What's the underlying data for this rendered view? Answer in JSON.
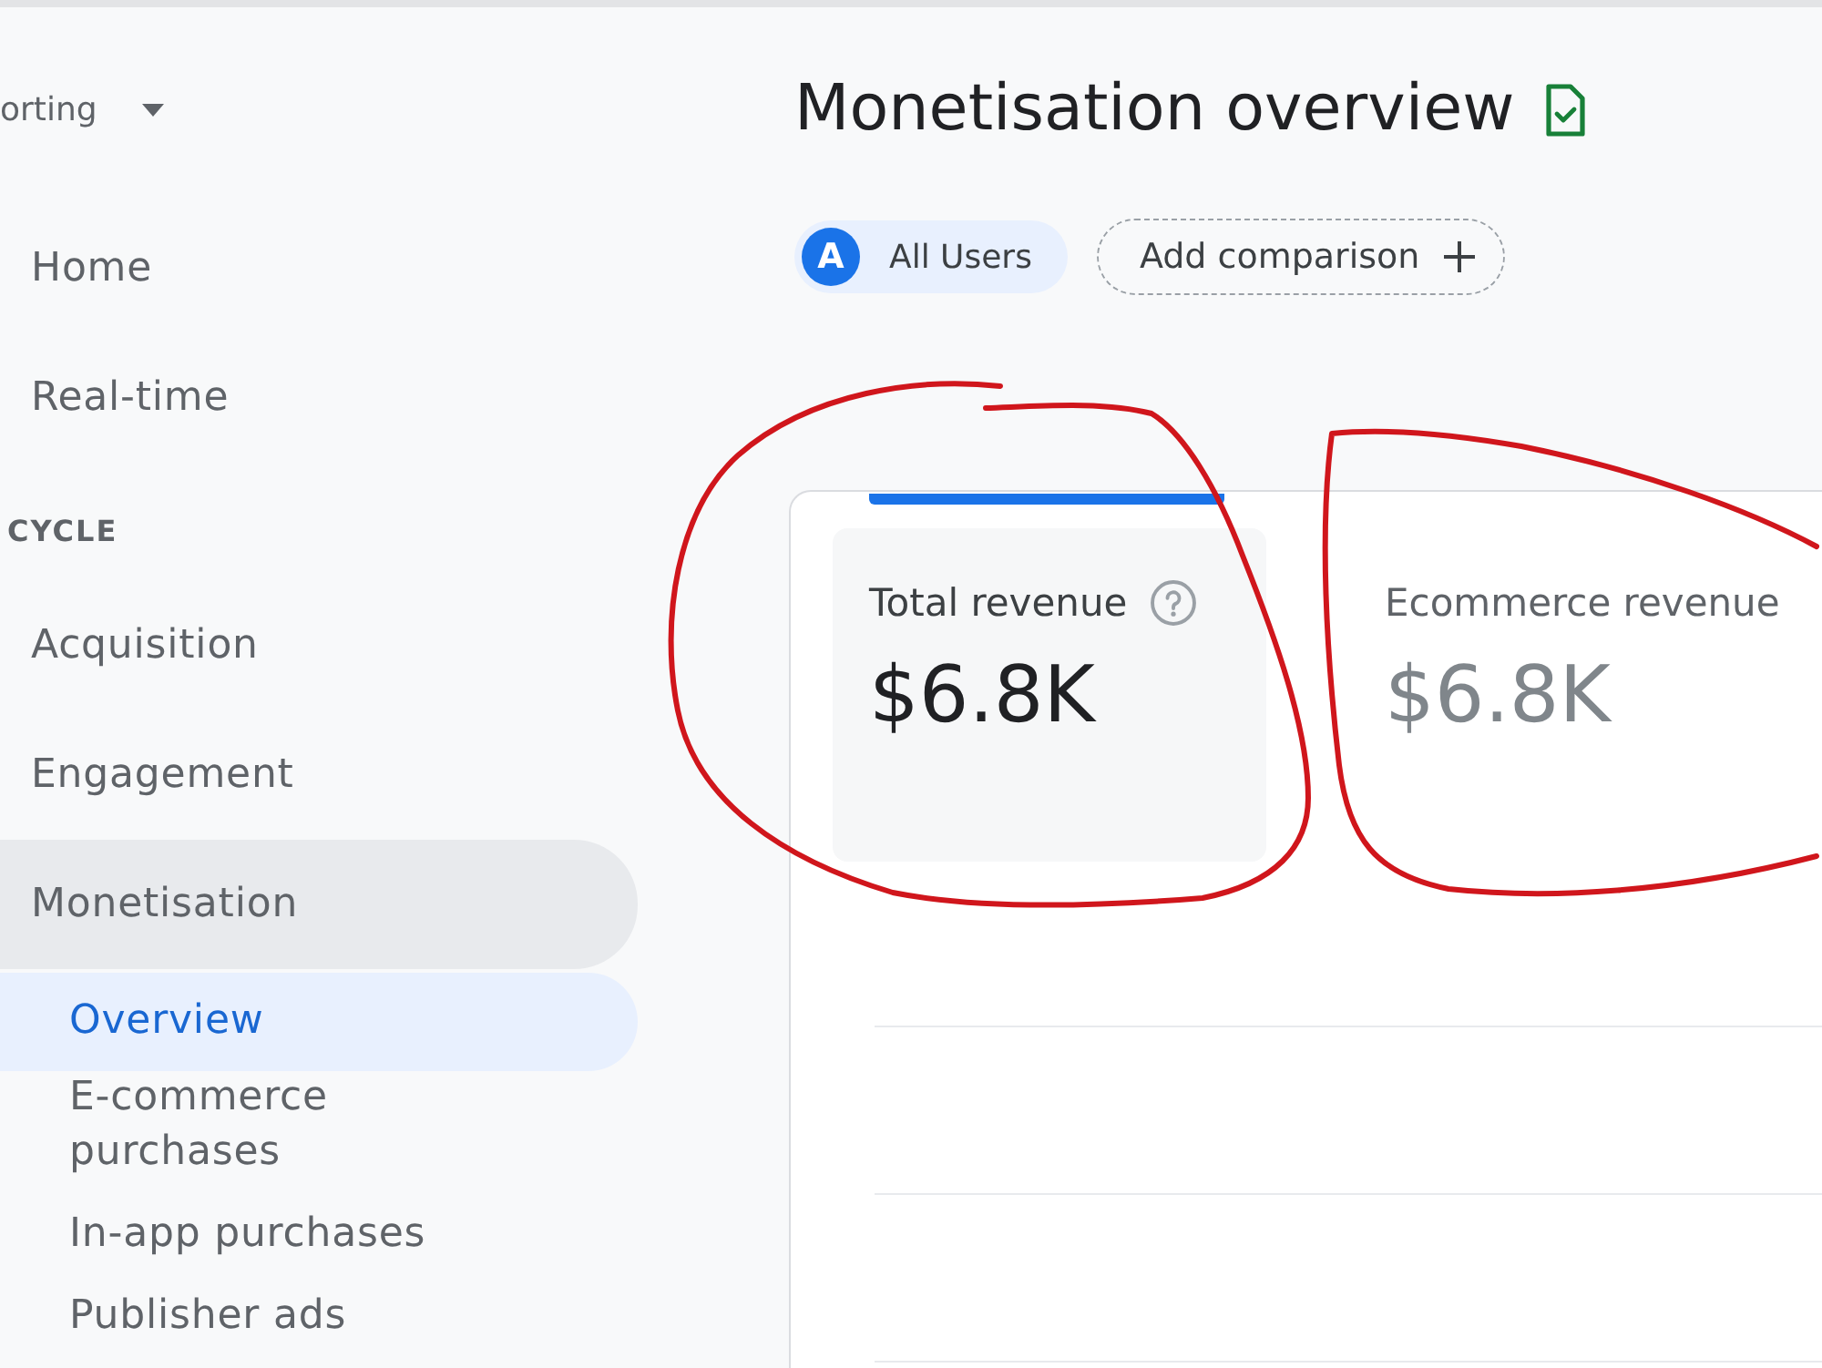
{
  "sidebar": {
    "dropdown": {
      "label": "orting"
    },
    "nav": [
      {
        "kind": "link",
        "label": "Home",
        "selected": false
      },
      {
        "kind": "link",
        "label": "Real-time",
        "selected": false
      },
      {
        "kind": "heading",
        "label": "CYCLE"
      },
      {
        "kind": "group",
        "label": "Acquisition",
        "expanded": false
      },
      {
        "kind": "group",
        "label": "Engagement",
        "expanded": false
      },
      {
        "kind": "group",
        "label": "Monetisation",
        "expanded": true,
        "children": [
          {
            "label": "Overview",
            "selected": true
          },
          {
            "label": "E-commerce purchases",
            "selected": false
          },
          {
            "label": "In-app purchases",
            "selected": false
          },
          {
            "label": "Publisher ads",
            "selected": false
          }
        ]
      }
    ]
  },
  "main": {
    "title": "Monetisation overview",
    "chips": [
      {
        "kind": "segment",
        "avatar": "A",
        "label": "All Users"
      },
      {
        "kind": "add",
        "label": "Add comparison"
      }
    ],
    "metrics": {
      "tabs": [
        {
          "label": "Total revenue",
          "value": "$6.8K",
          "selected": true,
          "circled": true
        },
        {
          "label": "Ecommerce revenue",
          "value": "$6.8K",
          "selected": false,
          "circled": true
        }
      ]
    }
  }
}
